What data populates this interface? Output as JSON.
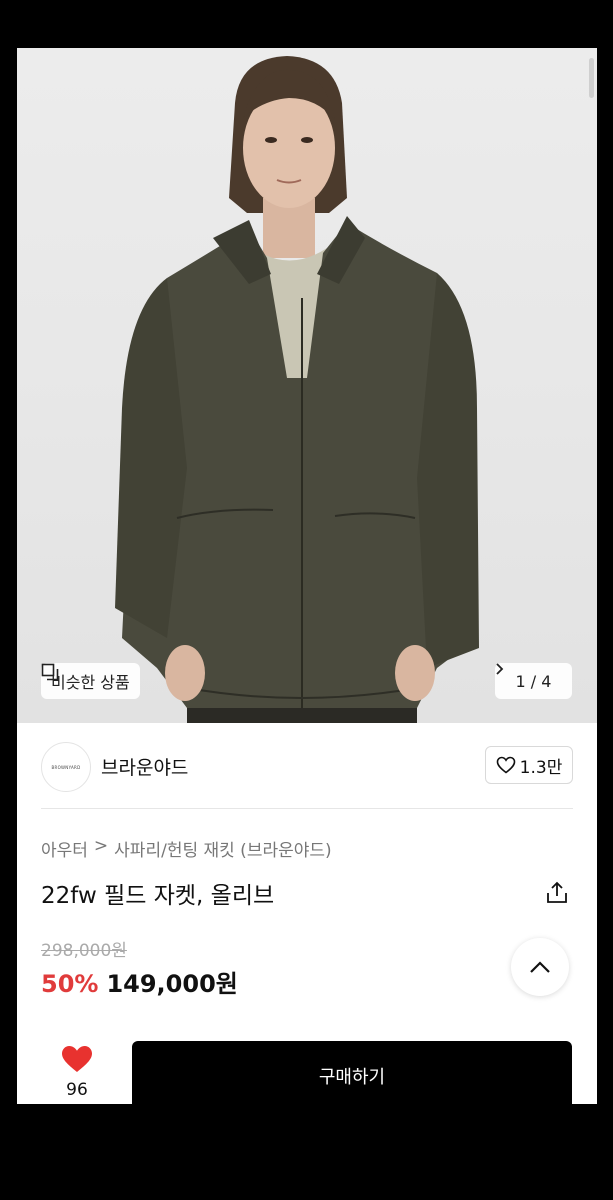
{
  "product_image": {
    "similar_label": "비슷한 상품",
    "counter": "1 / 4"
  },
  "brand": {
    "logo_text": "BROWNYARD",
    "name": "브라운야드",
    "like_count": "1.3만"
  },
  "breadcrumb": {
    "category": "아우터",
    "separator": ">",
    "subcategory": "사파리/헌팅 재킷 (브라운야드)"
  },
  "product": {
    "title": "22fw 필드 자켓, 올리브",
    "original_price": "298,000원",
    "discount": "50%",
    "sale_price": "149,000원"
  },
  "bottom_bar": {
    "wish_count": "96",
    "buy_label": "구매하기"
  },
  "colors": {
    "discount": "#e03b3b",
    "heart": "#e8322f",
    "buy_button": "#000000"
  },
  "icons": [
    "similar-items-icon",
    "chevron-right-icon",
    "heart-outline-icon",
    "share-icon",
    "chevron-up-icon",
    "heart-filled-icon"
  ]
}
